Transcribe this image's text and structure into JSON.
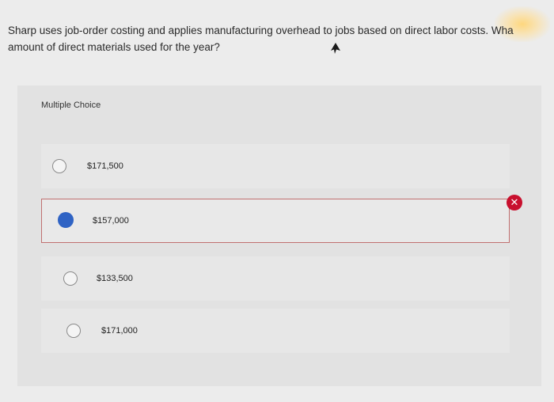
{
  "question": {
    "line1": "Sharp uses job-order costing and applies manufacturing overhead to jobs based on direct labor costs. Wha",
    "line2": "amount of direct materials used for the year?"
  },
  "multiple_choice_label": "Multiple Choice",
  "options": [
    {
      "label": "$171,500",
      "selected": false
    },
    {
      "label": "$157,000",
      "selected": true,
      "marked_incorrect": true
    },
    {
      "label": "$133,500",
      "selected": false
    },
    {
      "label": "$171,000",
      "selected": false
    }
  ],
  "incorrect_badge_icon": "x-icon",
  "colors": {
    "selected_radio": "#2f63c4",
    "incorrect_badge": "#c8102e",
    "selected_border": "#c07070"
  }
}
